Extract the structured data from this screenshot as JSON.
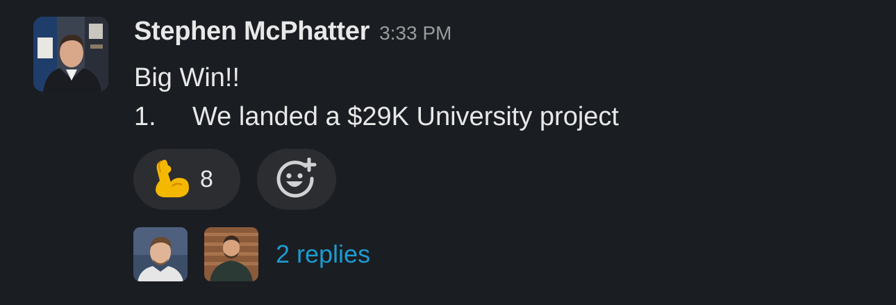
{
  "message": {
    "sender": "Stephen McPhatter",
    "timestamp": "3:33 PM",
    "line1": "Big Win!!",
    "list_number": "1.",
    "list_text": "We landed a $29K University project"
  },
  "reactions": [
    {
      "icon": "flexed-biceps-icon",
      "count": "8"
    }
  ],
  "add_reaction_icon": "add-reaction-icon",
  "thread": {
    "replies_label": "2 replies"
  },
  "colors": {
    "background": "#1a1d21",
    "link": "#1d9bd1",
    "pill": "#2c2d30"
  }
}
